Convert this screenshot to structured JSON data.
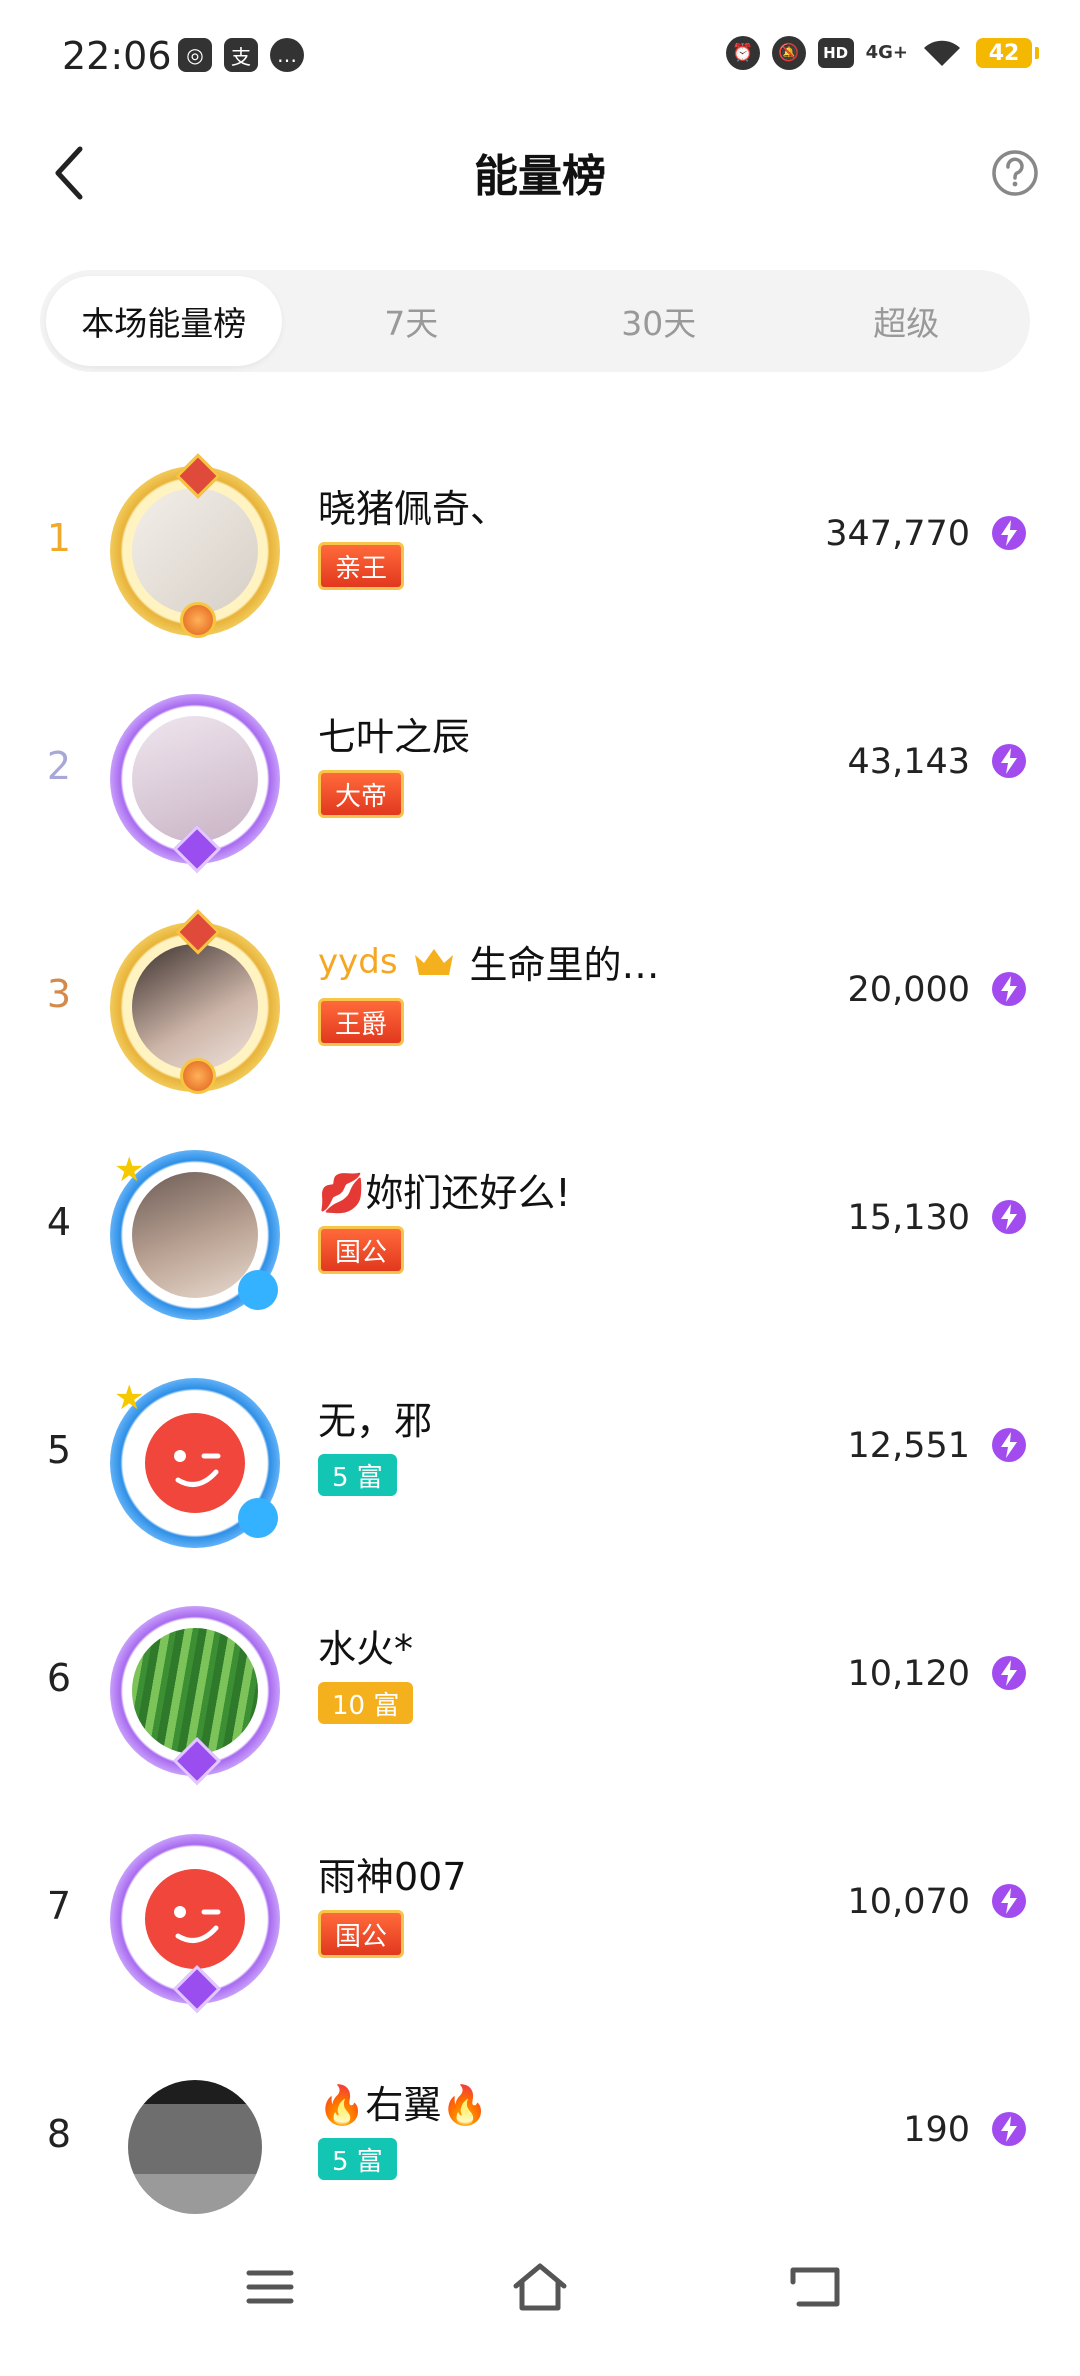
{
  "status_bar": {
    "time": "22:06",
    "left_icons": [
      "wechat-icon",
      "alipay-icon",
      "message-icon"
    ],
    "right_icons": [
      "alarm-icon",
      "mute-icon",
      "hd-icon",
      "signal-4g-icon",
      "wifi-icon"
    ],
    "hd_label": "HD",
    "network_label": "4G+",
    "battery": "42"
  },
  "header": {
    "title": "能量榜",
    "back_icon": "chevron-left-icon",
    "help_icon": "help-circle-icon"
  },
  "tabs": [
    {
      "label": "本场能量榜",
      "active": true
    },
    {
      "label": "7天",
      "active": false
    },
    {
      "label": "30天",
      "active": false
    },
    {
      "label": "超级",
      "active": false
    }
  ],
  "colors": {
    "rank_gold": "#f0a92a",
    "rank_silver": "#a8a8d8",
    "rank_bronze": "#d38a4a",
    "badge_royal": "#e2381f",
    "badge_rich_teal": "#13c6b3",
    "badge_rich_yellow": "#f5b11d",
    "energy_purple": "#a24cf0",
    "yyds_gold": "#f5a623"
  },
  "ranking": [
    {
      "rank": "1",
      "name": "晓猪佩奇、",
      "badge": "亲王",
      "score": "347,770"
    },
    {
      "rank": "2",
      "name": "七叶之辰",
      "badge": "大帝",
      "score": "43,143"
    },
    {
      "rank": "3",
      "prefix": "yyds",
      "name": "生命里的…",
      "badge": "王爵",
      "score": "20,000"
    },
    {
      "rank": "4",
      "name": "💋妳扪还好么!",
      "badge": "国公",
      "score": "15,130"
    },
    {
      "rank": "5",
      "name": "无，邪",
      "badge": "5 富",
      "score": "12,551"
    },
    {
      "rank": "6",
      "name": "水火*",
      "badge": "10 富",
      "score": "10,120"
    },
    {
      "rank": "7",
      "name": "雨神007",
      "badge": "国公",
      "score": "10,070"
    },
    {
      "rank": "8",
      "name": "🔥右翼🔥",
      "badge": "5 富",
      "score": "190"
    }
  ],
  "nav": {
    "menu_icon": "menu-icon",
    "home_icon": "home-icon",
    "back_icon": "back-arrow-icon"
  }
}
